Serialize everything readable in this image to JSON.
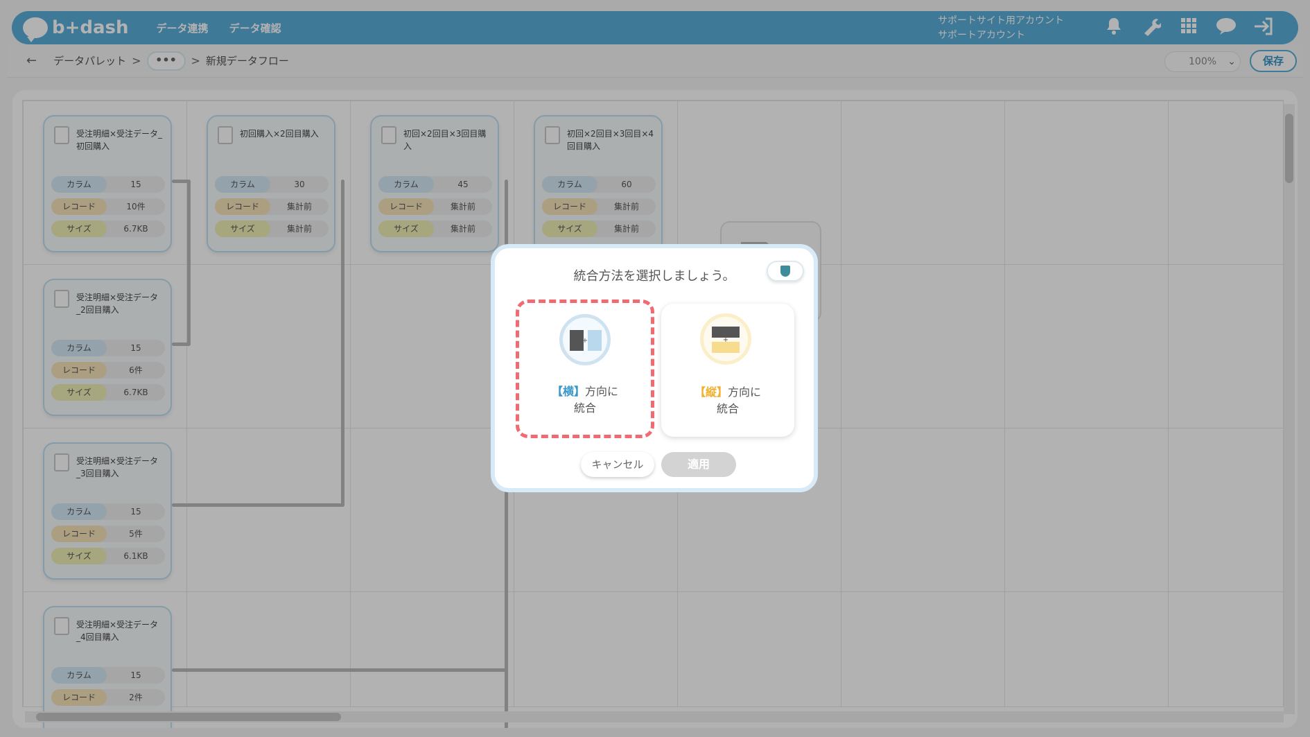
{
  "header": {
    "logo_text": "b+dash",
    "nav": [
      "データ連携",
      "データ確認"
    ],
    "account_line1": "サポートサイト用アカウント",
    "account_line2": "サポートアカウント",
    "icons": [
      "bell-icon",
      "wrench-icon",
      "grid-icon",
      "cloud-icon",
      "logout-icon"
    ],
    "accent_color": "#5aaed8"
  },
  "breadcrumb": {
    "back": "←",
    "first": "データパレット",
    "sep": ">",
    "more": "•••",
    "current": "新規データフロー"
  },
  "toolbar": {
    "zoom": "100%",
    "save": "保存"
  },
  "nodes": [
    {
      "title": "受注明細×受注データ_初回購入",
      "column": "15",
      "record": "10件",
      "size": "6.7KB"
    },
    {
      "title": "初回購入×2回目購入",
      "column": "30",
      "record": "集計前",
      "size": "集計前"
    },
    {
      "title": "初回×2回目×3回目購入",
      "column": "45",
      "record": "集計前",
      "size": "集計前"
    },
    {
      "title": "初回×2回目×3回目×4回目購入",
      "column": "60",
      "record": "集計前",
      "size": "集計前"
    },
    {
      "title": "受注明細×受注データ_2回目購入",
      "column": "15",
      "record": "6件",
      "size": "6.7KB"
    },
    {
      "title": "受注明細×受注データ_3回目購入",
      "column": "15",
      "record": "5件",
      "size": "6.1KB"
    },
    {
      "title": "受注明細×受注データ_4回目購入",
      "column": "15",
      "record": "2件",
      "size": ""
    }
  ],
  "labels": {
    "column": "カラム",
    "record": "レコード",
    "size": "サイズ"
  },
  "modal": {
    "title": "統合方法を選択しましょう。",
    "horizontal": {
      "bracket": "【横】",
      "text1": "方向に",
      "text2": "統合",
      "color": "#3a96c8"
    },
    "vertical": {
      "bracket": "【縦】",
      "text1": "方向に",
      "text2": "統合",
      "color": "#f2b02c"
    },
    "cancel": "キャンセル",
    "apply": "適用"
  }
}
